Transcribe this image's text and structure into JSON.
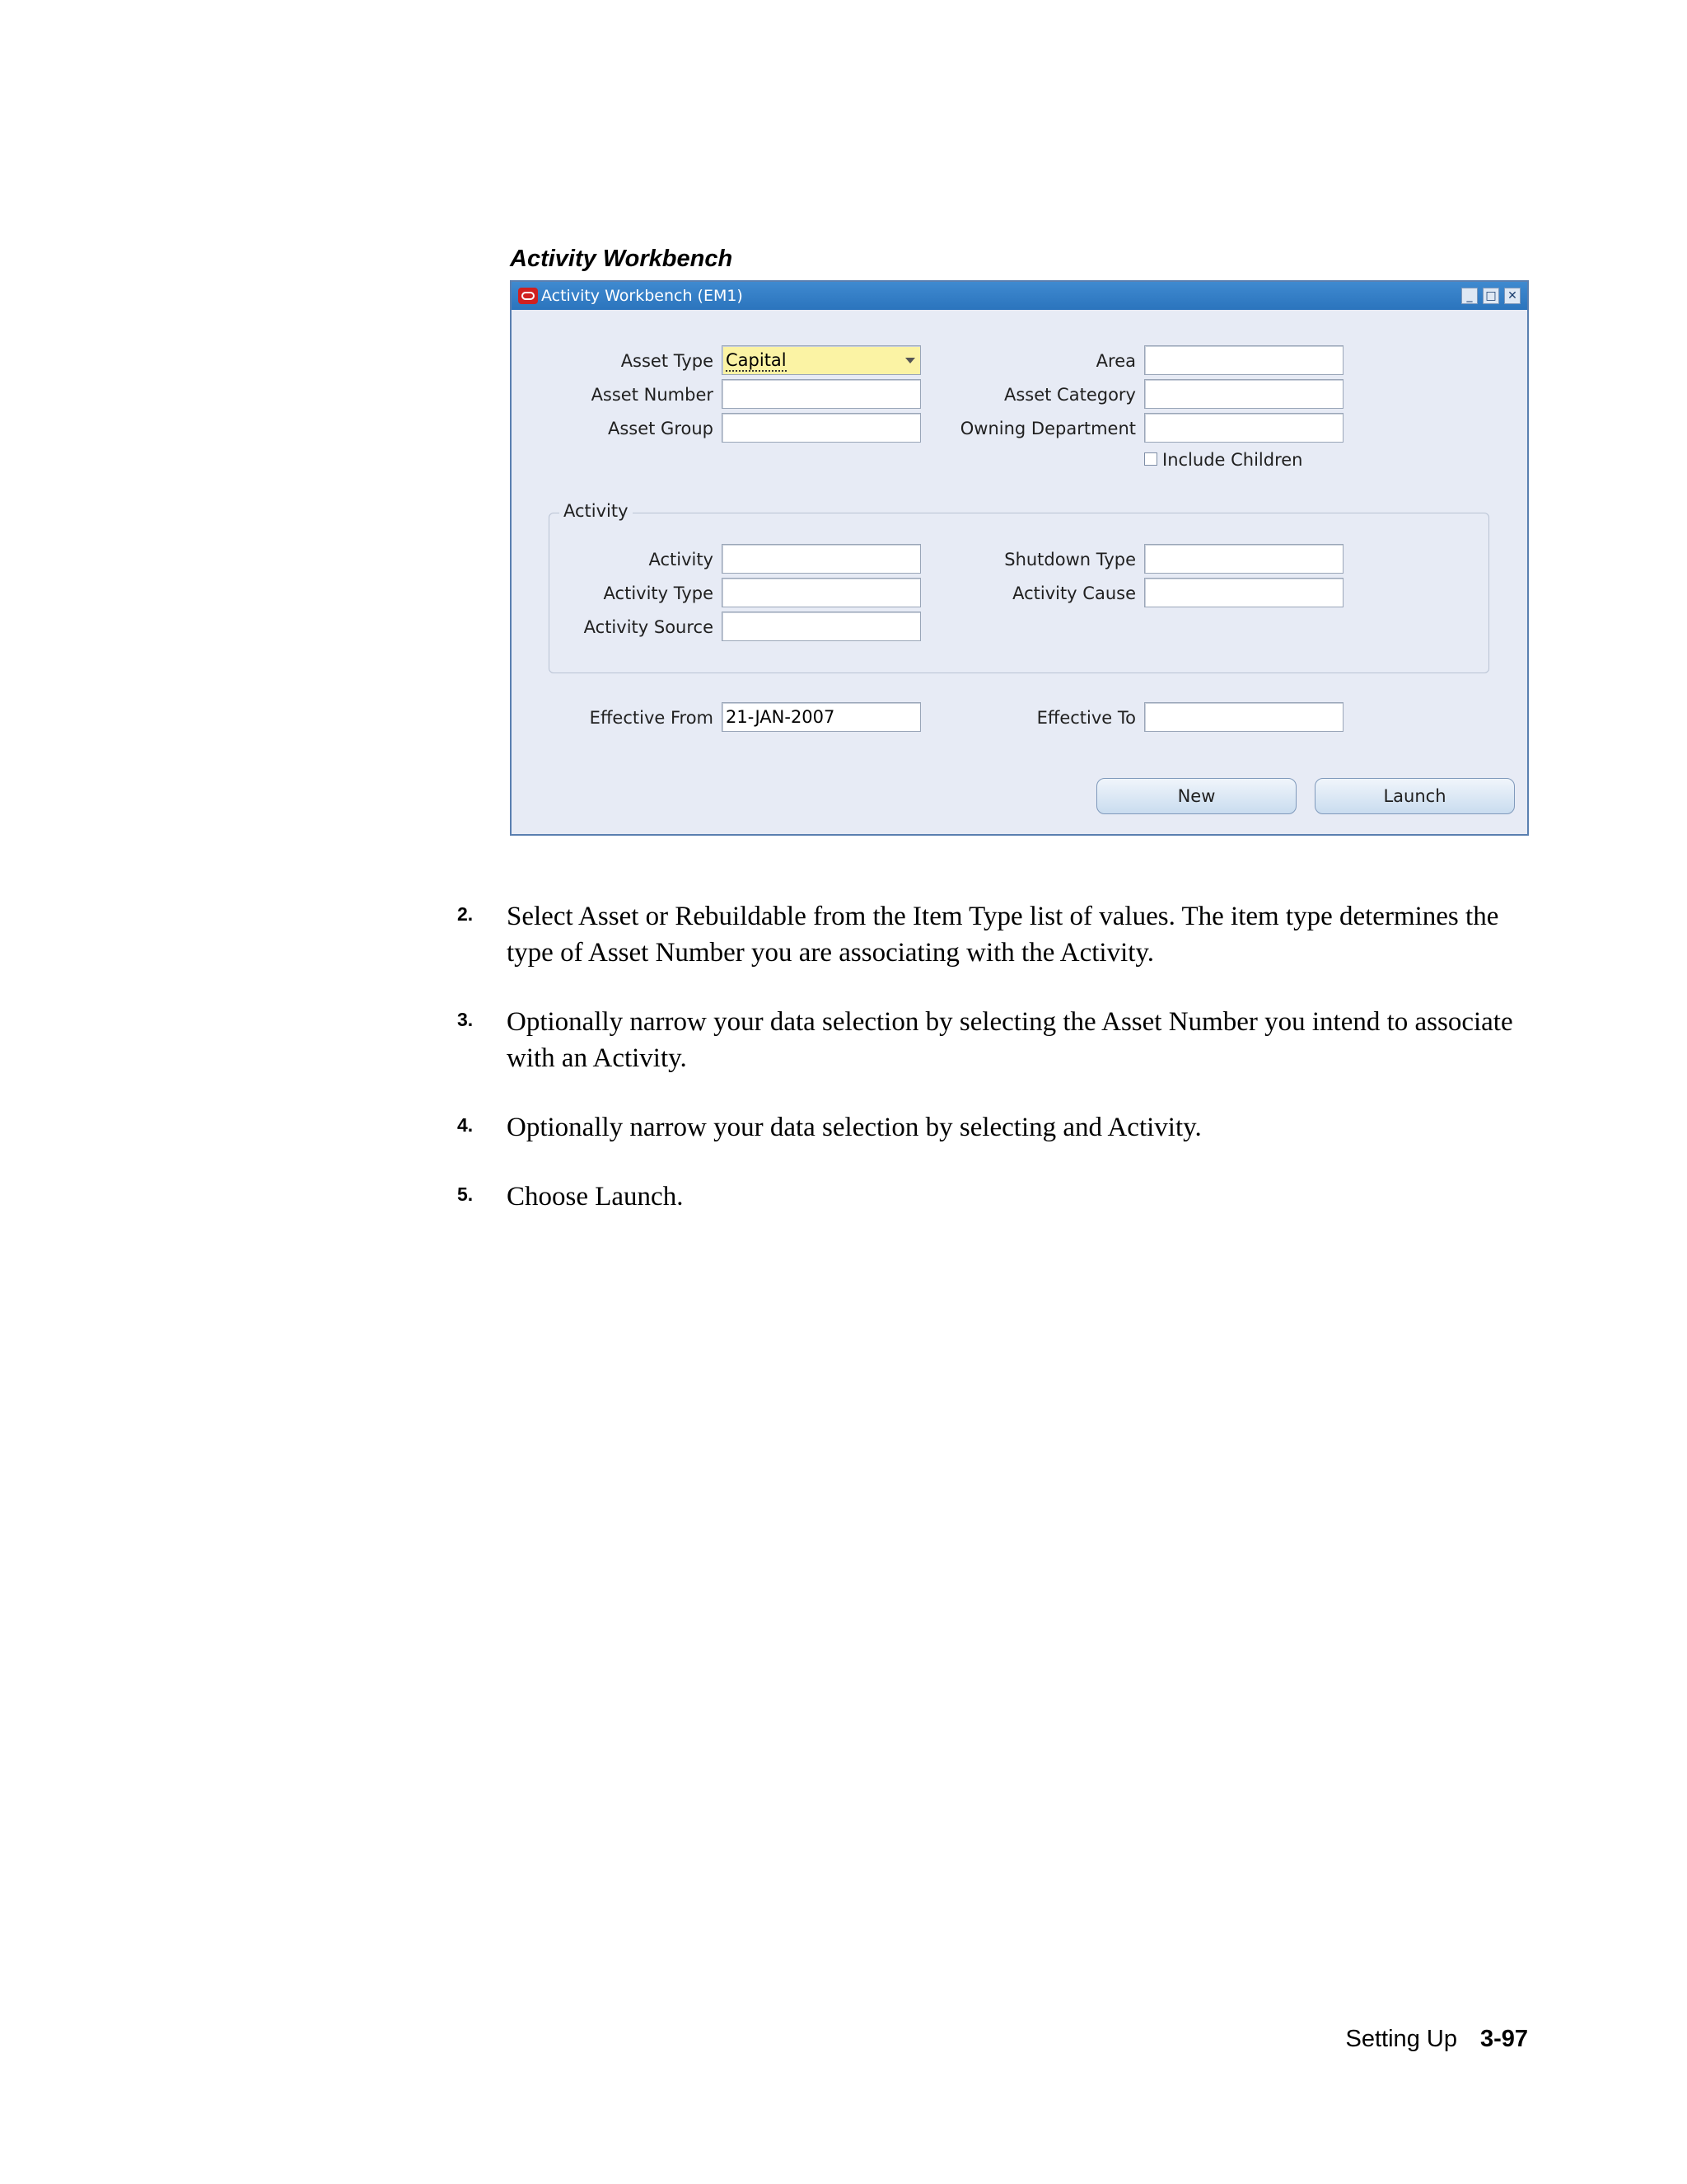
{
  "caption": "Activity Workbench",
  "window": {
    "title": "Activity Workbench (EM1)",
    "controls": {
      "minimize": "_",
      "maximize": "□",
      "close": "✕"
    }
  },
  "form": {
    "asset_type": {
      "label": "Asset Type",
      "value": "Capital"
    },
    "asset_number": {
      "label": "Asset Number",
      "value": ""
    },
    "asset_group": {
      "label": "Asset Group",
      "value": ""
    },
    "area": {
      "label": "Area",
      "value": ""
    },
    "asset_category": {
      "label": "Asset Category",
      "value": ""
    },
    "owning_department": {
      "label": "Owning Department",
      "value": ""
    },
    "include_children": {
      "label": "Include Children",
      "checked": false
    },
    "activity_group": {
      "title": "Activity",
      "activity": {
        "label": "Activity",
        "value": ""
      },
      "activity_type": {
        "label": "Activity Type",
        "value": ""
      },
      "activity_source": {
        "label": "Activity Source",
        "value": ""
      },
      "shutdown_type": {
        "label": "Shutdown Type",
        "value": ""
      },
      "activity_cause": {
        "label": "Activity Cause",
        "value": ""
      }
    },
    "effective_from": {
      "label": "Effective From",
      "value": "21-JAN-2007"
    },
    "effective_to": {
      "label": "Effective To",
      "value": ""
    },
    "buttons": {
      "new": "New",
      "launch": "Launch"
    }
  },
  "steps": [
    {
      "number": "2.",
      "text": "Select Asset or Rebuildable from the Item Type list of values. The item type determines the type of Asset Number you are associating with the Activity."
    },
    {
      "number": "3.",
      "text": "Optionally narrow your data selection by selecting the Asset Number you intend to associate with an Activity."
    },
    {
      "number": "4.",
      "text": "Optionally narrow your data selection by selecting and Activity."
    },
    {
      "number": "5.",
      "text": "Choose Launch."
    }
  ],
  "footer": {
    "section": "Setting Up",
    "page": "3-97"
  }
}
